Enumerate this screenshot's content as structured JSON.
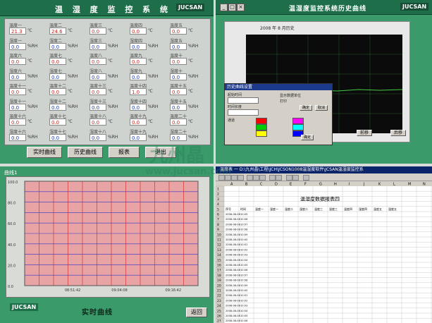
{
  "q1": {
    "title": "温 湿 度 监 控 系 统",
    "logo": "JUCSAN",
    "win_buttons": [
      "_",
      "□",
      "×"
    ],
    "sensors": [
      {
        "label": "温度一",
        "value": "21.3",
        "unit": "℃"
      },
      {
        "label": "温度二",
        "value": "24.6",
        "unit": "℃"
      },
      {
        "label": "温度三",
        "value": "0.0",
        "unit": "℃"
      },
      {
        "label": "温度四",
        "value": "0.0",
        "unit": "℃"
      },
      {
        "label": "温度五",
        "value": "0.0",
        "unit": "℃"
      },
      {
        "label": "湿度一",
        "value": "0.0",
        "unit": "%RH"
      },
      {
        "label": "湿度二",
        "value": "0.0",
        "unit": "%RH"
      },
      {
        "label": "湿度三",
        "value": "0.0",
        "unit": "%RH"
      },
      {
        "label": "湿度四",
        "value": "0.0",
        "unit": "%RH"
      },
      {
        "label": "湿度五",
        "value": "0.0",
        "unit": "%RH"
      },
      {
        "label": "温度六",
        "value": "0.0",
        "unit": "℃"
      },
      {
        "label": "温度七",
        "value": "0.0",
        "unit": "℃"
      },
      {
        "label": "温度八",
        "value": "0.0",
        "unit": "℃"
      },
      {
        "label": "温度九",
        "value": "0.0",
        "unit": "℃"
      },
      {
        "label": "温度十",
        "value": "0.0",
        "unit": "℃"
      },
      {
        "label": "湿度六",
        "value": "0.0",
        "unit": "%RH"
      },
      {
        "label": "湿度七",
        "value": "0.0",
        "unit": "%RH"
      },
      {
        "label": "湿度八",
        "value": "0.0",
        "unit": "%RH"
      },
      {
        "label": "湿度九",
        "value": "0.0",
        "unit": "%RH"
      },
      {
        "label": "湿度十",
        "value": "0.0",
        "unit": "%RH"
      },
      {
        "label": "温度十一",
        "value": "0.0",
        "unit": "℃"
      },
      {
        "label": "温度十二",
        "value": "0.0",
        "unit": "℃"
      },
      {
        "label": "温度十三",
        "value": "0.0",
        "unit": "℃"
      },
      {
        "label": "温度十四",
        "value": "1.0",
        "unit": "℃"
      },
      {
        "label": "温度十五",
        "value": "0.0",
        "unit": "℃"
      },
      {
        "label": "湿度十一",
        "value": "0.0",
        "unit": "%RH"
      },
      {
        "label": "湿度十二",
        "value": "0.0",
        "unit": "%RH"
      },
      {
        "label": "湿度十三",
        "value": "0.0",
        "unit": "%RH"
      },
      {
        "label": "湿度十四",
        "value": "0.0",
        "unit": "%RH"
      },
      {
        "label": "湿度十五",
        "value": "0.0",
        "unit": "%RH"
      },
      {
        "label": "温度十六",
        "value": "0.0",
        "unit": "℃"
      },
      {
        "label": "温度十七",
        "value": "0.0",
        "unit": "℃"
      },
      {
        "label": "温度十八",
        "value": "0.0",
        "unit": "℃"
      },
      {
        "label": "温度十九",
        "value": "0.0",
        "unit": "℃"
      },
      {
        "label": "温度二十",
        "value": "0.0",
        "unit": "℃"
      },
      {
        "label": "湿度十六",
        "value": "0.0",
        "unit": "%RH"
      },
      {
        "label": "湿度十七",
        "value": "0.0",
        "unit": "%RH"
      },
      {
        "label": "湿度十八",
        "value": "0.0",
        "unit": "%RH"
      },
      {
        "label": "湿度十九",
        "value": "0.0",
        "unit": "%RH"
      },
      {
        "label": "湿度二十",
        "value": "0.0",
        "unit": "%RH"
      }
    ],
    "buttons": [
      "实时曲线",
      "历史曲线",
      "报表",
      "退出"
    ]
  },
  "q2": {
    "title": "温湿度监控系统历史曲线",
    "logo": "JUCSAN",
    "chart_caption": "2008 年 8 月历史",
    "buttons": [
      "前移",
      "后移"
    ],
    "dialog": {
      "title": "历史曲线设置",
      "field1_label": "起始时间",
      "field2_label": "时间长度",
      "opt1": "显示数据单位",
      "opt2": "打印",
      "ok": "确定",
      "cancel": "取消",
      "row_label": "通道",
      "swatch_colors": [
        "#ff0000",
        "#00cc00",
        "#ffff00",
        "#ff00ff",
        "#00ffff",
        "#0000ff"
      ]
    }
  },
  "q3": {
    "title": "曲线1",
    "y_ticks": [
      "100.0",
      "80.0",
      "60.0",
      "40.0",
      "20.0",
      "0.0"
    ],
    "x_ticks": [
      "08:51:42",
      "09:04:08",
      "09:16:42"
    ],
    "caption": "实时曲线",
    "logo": "JUCSAN",
    "back_button": "返回",
    "series_colors": [
      "#cc2222",
      "#3333cc"
    ]
  },
  "q4": {
    "title": "温度表 一 D:\\九州晶\\工程\\JCH\\JCSON1008温湿度软件\\JCSAN温湿度监控系",
    "sheet_title": "温湿度数据报表四",
    "col_letters": [
      "A",
      "B",
      "C",
      "D",
      "E",
      "F",
      "G",
      "H",
      "I",
      "J",
      "K",
      "L",
      "M",
      "N"
    ],
    "header_row": [
      "序号",
      "时间",
      "温度一",
      "湿度一",
      "温度二",
      "湿度二",
      "温度三",
      "湿度三",
      "温度四",
      "湿度四",
      "温度五",
      "湿度五"
    ],
    "date_col": "2008-08-08",
    "time_prefix": "10:0"
  },
  "watermarks": [
    "九州晶",
    "www.jucsan.com"
  ]
}
